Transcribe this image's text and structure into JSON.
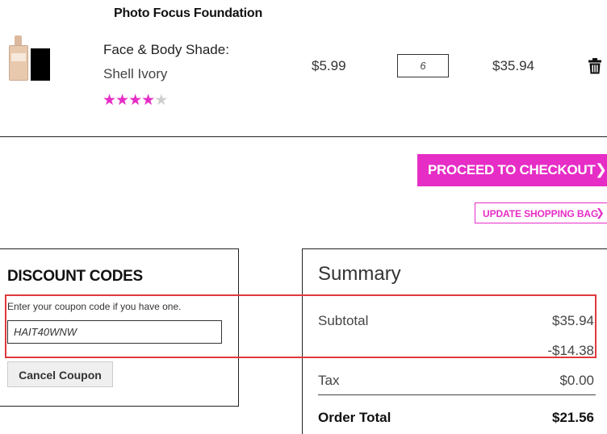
{
  "product": {
    "name": "Photo Focus Foundation",
    "variant_label": "Face & Body Shade:",
    "variant_value": "Shell Ivory",
    "rating": 4,
    "rating_max": 5,
    "unit_price": "$5.99",
    "quantity": "6",
    "line_total": "$35.94"
  },
  "actions": {
    "checkout_label": "PROCEED TO CHECKOUT",
    "update_label": "UPDATE SHOPPING BAG"
  },
  "discount": {
    "title": "DISCOUNT CODES",
    "hint": "Enter your coupon code if you have one.",
    "code": "HAIT40WNW",
    "cancel_label": "Cancel Coupon"
  },
  "summary": {
    "title": "Summary",
    "subtotal_label": "Subtotal",
    "subtotal_value": "$35.94",
    "discount_value": "-$14.38",
    "tax_label": "Tax",
    "tax_value": "$0.00",
    "total_label": "Order Total",
    "total_value": "$21.56"
  },
  "colors": {
    "accent": "#e62dc6",
    "highlight": "#e0393b"
  },
  "icons": {
    "trash": "trash-icon",
    "chevron": "chevron-right-icon"
  }
}
